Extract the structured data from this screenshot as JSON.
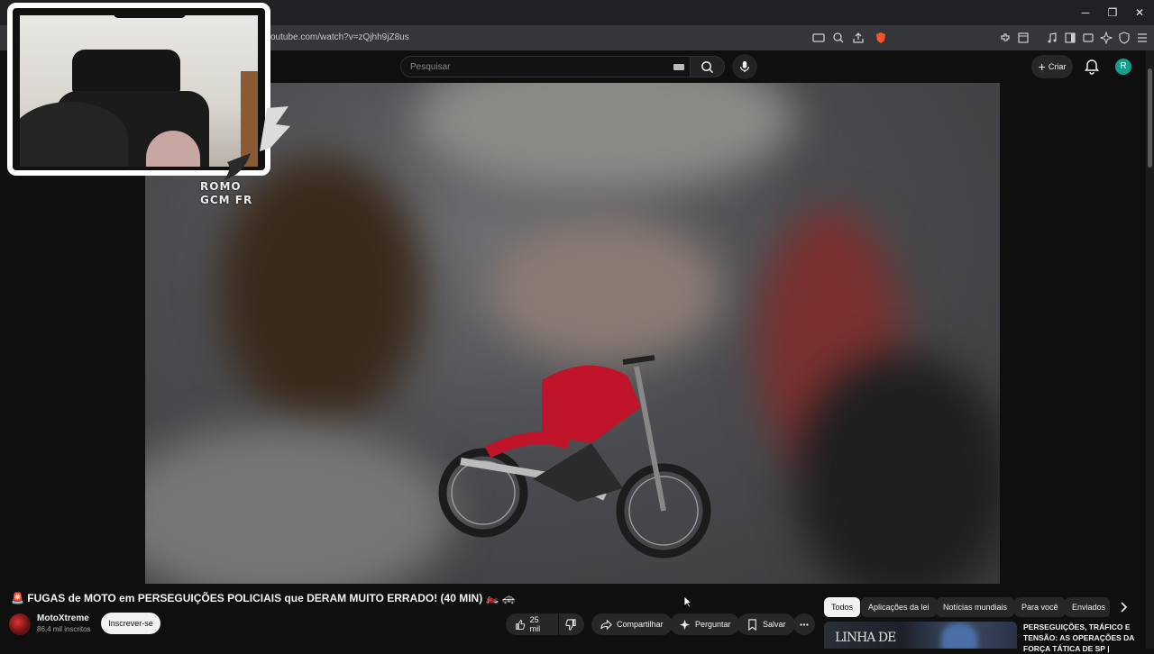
{
  "browser": {
    "url": "outube.com/watch?v=zQjhh9jZ8us",
    "window_controls": [
      "minimize",
      "maximize",
      "close"
    ]
  },
  "header": {
    "search_placeholder": "Pesquisar",
    "create_label": "Criar",
    "avatar_initial": "R",
    "avatar_color": "#12a08c"
  },
  "overlay": {
    "logo_line1": "ROMO",
    "logo_line2": "GCM FR"
  },
  "video": {
    "title": "🚨 FUGAS de MOTO em PERSEGUIÇÕES POLICIAIS que DERAM MUITO ERRADO! (40 MIN) 🏍️ 🚓",
    "channel": "MotoXtreme",
    "subscribers": "86,4 mil inscritos",
    "subscribe_label": "Inscrever-se",
    "likes": "25 mil",
    "share_label": "Compartilhar",
    "ask_label": "Perguntar",
    "save_label": "Salvar"
  },
  "chips": [
    "Todos",
    "Aplicações da lei",
    "Notícias mundiais",
    "Para você",
    "Enviados"
  ],
  "recommendation": {
    "thumb_text": "LINHA DE",
    "title": "PERSEGUIÇÕES, TRÁFICO E TENSÃO: AS OPERAÇÕES DA FORÇA TÁTICA DE SP |"
  },
  "colors": {
    "background": "#0f0f0f",
    "motorcycle": "#c0142a"
  }
}
